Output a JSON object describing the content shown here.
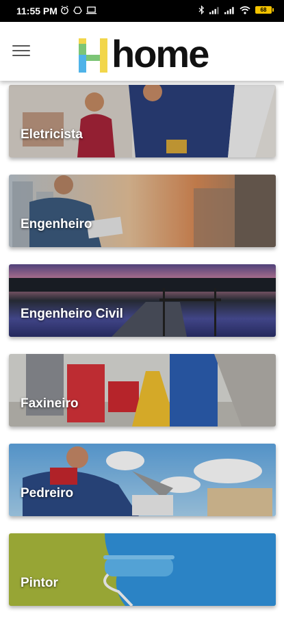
{
  "status_bar": {
    "time": "11:55 PM",
    "battery": "68",
    "icons_left": [
      "alarm-icon",
      "drive-icon",
      "laptop-icon"
    ],
    "icons_right": [
      "bluetooth-icon",
      "signal-icon",
      "signal-icon",
      "wifi-icon",
      "battery-icon"
    ]
  },
  "header": {
    "logo_letter": "H",
    "logo_text": "home",
    "menu_icon": "hamburger-menu-icon"
  },
  "categories": [
    {
      "label": "Eletricista"
    },
    {
      "label": "Engenheiro"
    },
    {
      "label": "Engenheiro Civil"
    },
    {
      "label": "Faxineiro"
    },
    {
      "label": "Pedreiro"
    },
    {
      "label": "Pintor"
    }
  ],
  "colors": {
    "logo_yellow": "#f2d64b",
    "logo_green": "#7cc576",
    "logo_blue": "#4fb3e8",
    "logo_text": "#111111",
    "painter_green": "#a4b43a",
    "painter_blue": "#2f8fd6"
  }
}
